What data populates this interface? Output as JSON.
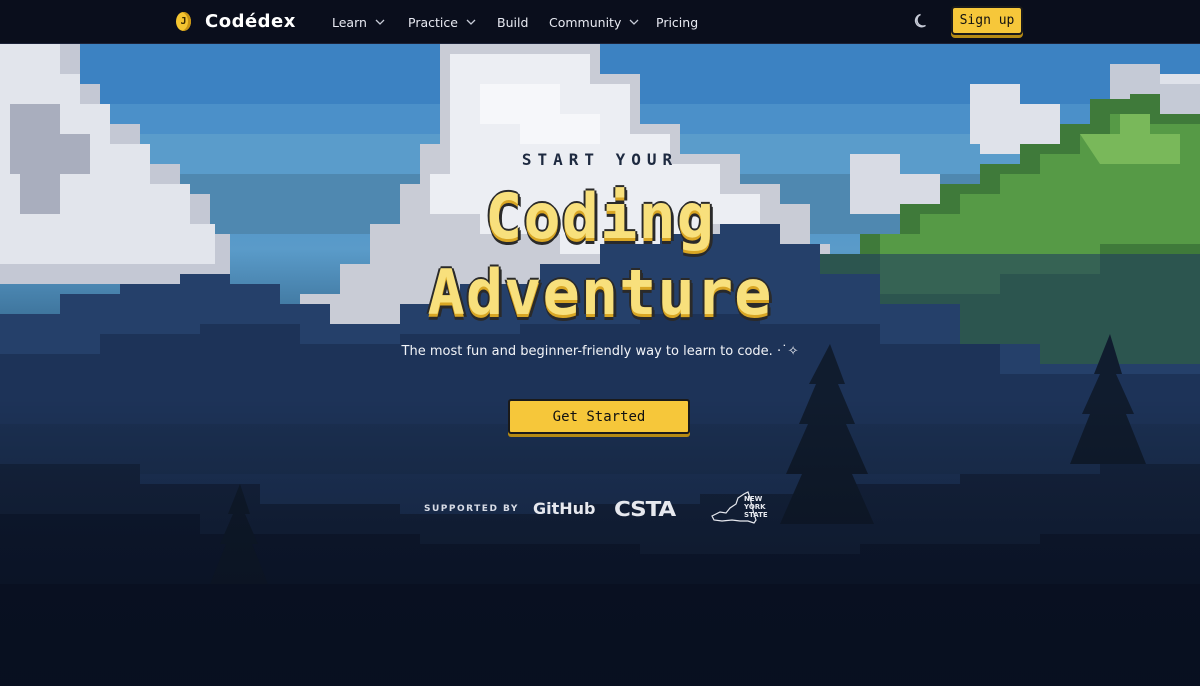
{
  "brand": {
    "name": "Codédex",
    "coin_letter": "J"
  },
  "nav": {
    "items": [
      {
        "label": "Learn",
        "has_dropdown": true
      },
      {
        "label": "Practice",
        "has_dropdown": true
      },
      {
        "label": "Build",
        "has_dropdown": false
      },
      {
        "label": "Community",
        "has_dropdown": true
      },
      {
        "label": "Pricing",
        "has_dropdown": false
      }
    ],
    "theme_icon": "moon-icon",
    "signup_label": "Sign up"
  },
  "hero": {
    "tagline": "START YOUR",
    "title_line1": "Coding",
    "title_line2": "Adventure",
    "subtitle": "The most fun and beginner-friendly way to learn to code. ·˙✧",
    "cta_label": "Get Started"
  },
  "supported": {
    "label": "SUPPORTED BY",
    "logos": [
      "GitHub",
      "CSTA",
      "NEW YORK STATE"
    ],
    "nys_lines": [
      "NEW",
      "YORK",
      "STATE"
    ]
  },
  "colors": {
    "accent": "#f6c73a",
    "nav_bg": "#0a0e1c",
    "title": "#f8e07c"
  }
}
